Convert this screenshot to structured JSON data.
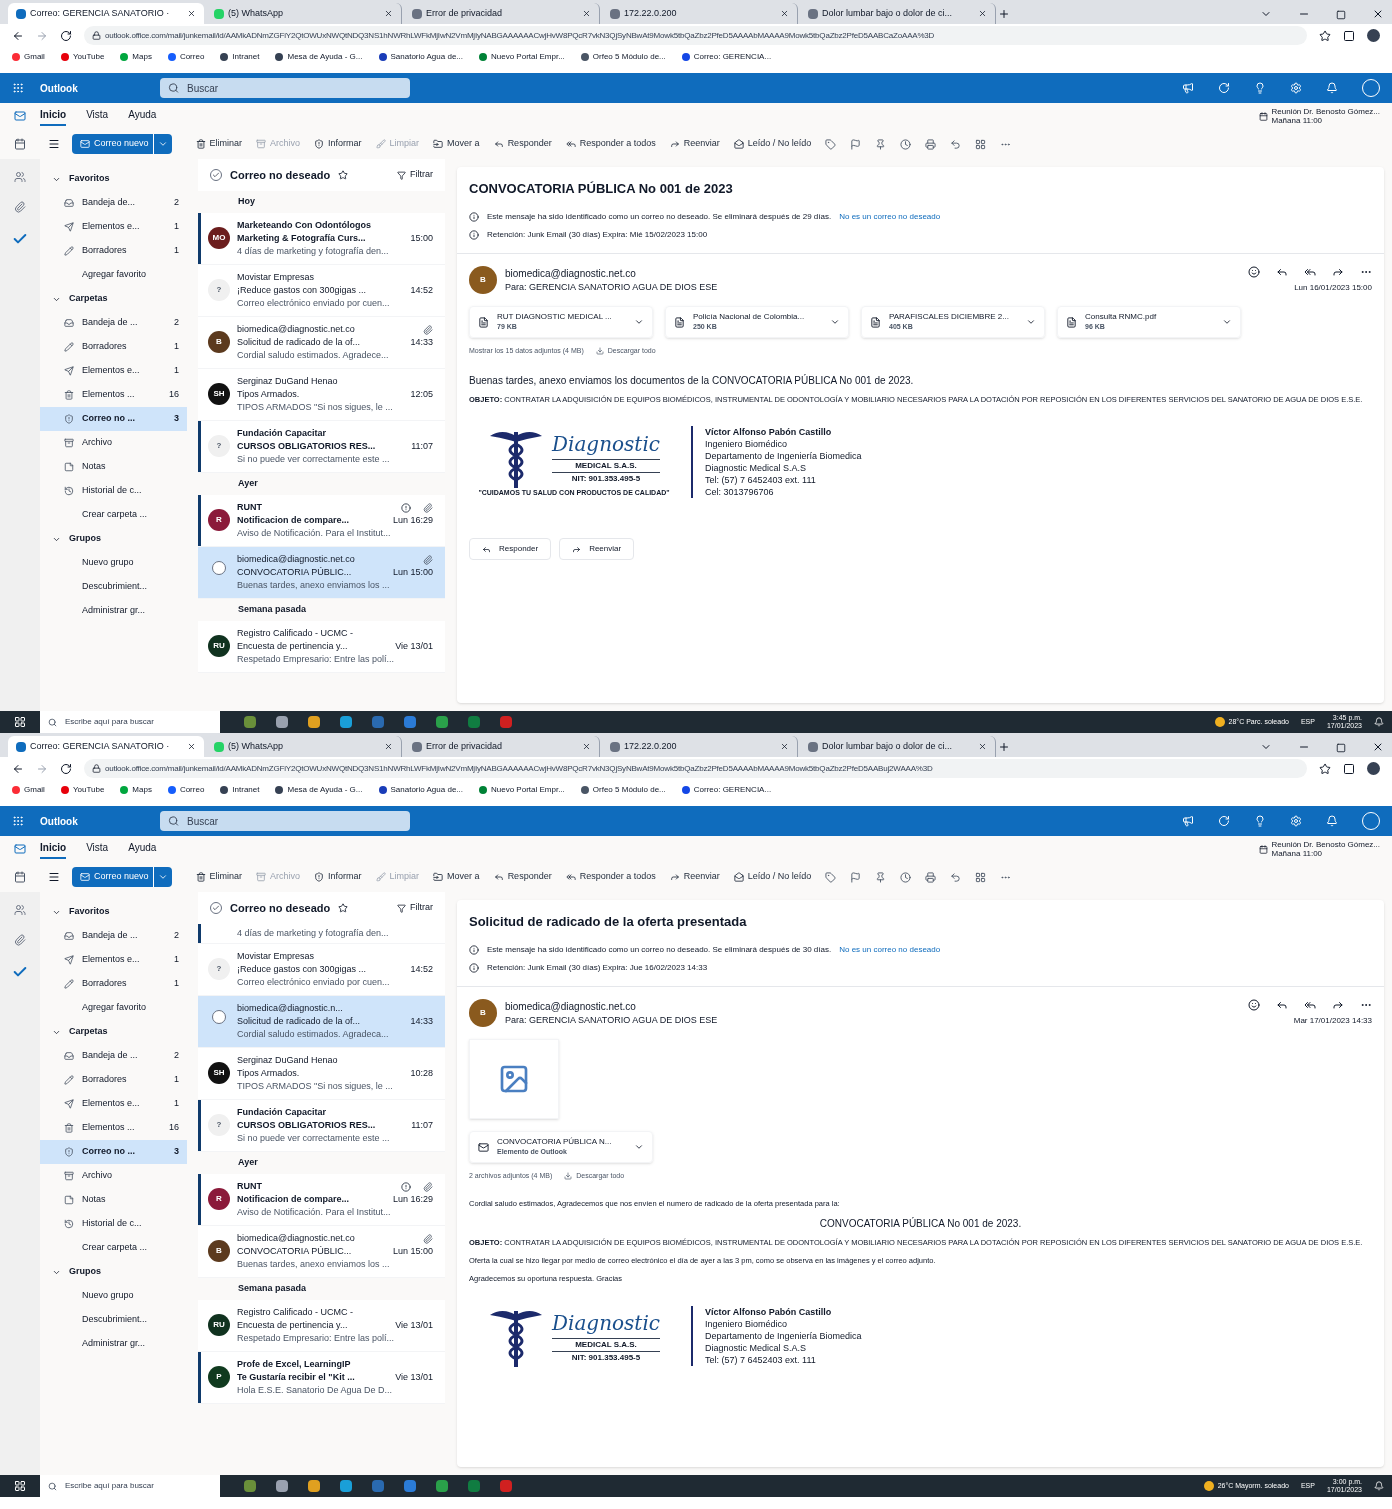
{
  "screens": [
    {
      "browser_tabs": [
        {
          "title": "Correo: GERENCIA SANATORIO ·",
          "selected": true
        },
        {
          "title": "(5) WhatsApp",
          "selected": false
        },
        {
          "title": "Error de privacidad",
          "selected": false
        },
        {
          "title": "172.22.0.200",
          "selected": false
        },
        {
          "title": "Dolor lumbar bajo o dolor de ci...",
          "selected": false
        }
      ],
      "address": "outlook.office.com/mail/junkemail/id/AAMkADNmZGFiY2QtOWUxNWQtNDQ3NS1hNWRhLWFkMjIwN2VmMjIyNABGAAAAAACwjHvW8PQcR7vkN3QjSyNBwAt9Mowk5tbQaZbz2PfeD5AAAAbMAAAA9Mowk5tbQaZbz2PfeD5AABCaZoAAA%3D",
      "bookmarks": [
        "Gmail",
        "YouTube",
        "Maps",
        "Correo",
        "Intranet",
        "Mesa de Ayuda - G...",
        "Sanatorio Agua de...",
        "Nuevo Portal Empr...",
        "Orfeo 5 Módulo de...",
        "Correo: GERENCIA..."
      ],
      "app_name": "Outlook",
      "search_placeholder": "Buscar",
      "reminder": {
        "title": "Reunión Dr. Benosto Gómez...",
        "time": "Mañana 11:00"
      },
      "ribbon_tabs": [
        {
          "label": "Inicio",
          "selected": true
        },
        {
          "label": "Vista",
          "selected": false
        },
        {
          "label": "Ayuda",
          "selected": false
        }
      ],
      "new_mail": "Correo nuevo",
      "toolbar": [
        {
          "label": "Eliminar",
          "disabled": false
        },
        {
          "label": "Archivo",
          "disabled": true
        },
        {
          "label": "Informar",
          "disabled": false
        },
        {
          "label": "Limpiar",
          "disabled": true
        },
        {
          "label": "Mover a",
          "disabled": false
        },
        {
          "label": "Responder",
          "disabled": false
        },
        {
          "label": "Responder a todos",
          "disabled": false
        },
        {
          "label": "Reenviar",
          "disabled": false
        },
        {
          "label": "Leído / No leído",
          "disabled": false
        }
      ],
      "nav_sections": [
        {
          "title": "Favoritos",
          "items": [
            {
              "kind": "inbox",
              "label": "Bandeja de...",
              "count": "2",
              "selected": false
            },
            {
              "kind": "sent",
              "label": "Elementos e...",
              "count": "1",
              "selected": false
            },
            {
              "kind": "drafts",
              "label": "Borradores",
              "count": "1",
              "selected": false
            },
            {
              "kind": "action",
              "label": "Agregar favorito",
              "selected": false
            }
          ]
        },
        {
          "title": "Carpetas",
          "items": [
            {
              "kind": "inbox",
              "label": "Bandeja de ...",
              "count": "2",
              "selected": false
            },
            {
              "kind": "drafts",
              "label": "Borradores",
              "count": "1",
              "selected": false
            },
            {
              "kind": "sent",
              "label": "Elementos e...",
              "count": "1",
              "selected": false
            },
            {
              "kind": "deleted",
              "label": "Elementos ...",
              "count": "16",
              "selected": false
            },
            {
              "kind": "junk",
              "label": "Correo no ...",
              "count": "3",
              "selected": true
            },
            {
              "kind": "archive",
              "label": "Archivo",
              "selected": false
            },
            {
              "kind": "notes",
              "label": "Notas",
              "selected": false
            },
            {
              "kind": "history",
              "label": "Historial de c...",
              "selected": false
            },
            {
              "kind": "action",
              "label": "Crear carpeta ...",
              "selected": false
            }
          ]
        },
        {
          "title": "Grupos",
          "items": [
            {
              "kind": "action",
              "label": "Nuevo grupo",
              "selected": false
            },
            {
              "kind": "action",
              "label": "Descubrimient...",
              "selected": false
            },
            {
              "kind": "action",
              "label": "Administrar gr...",
              "selected": false
            }
          ]
        }
      ],
      "list_title": "Correo no deseado",
      "filter": "Filtrar",
      "groups": [
        {
          "heading": "Hoy",
          "messages": [
            {
              "initials": "MO",
              "color": "#6b1d1d",
              "sender": "Marketeando Con Odontólogos",
              "subject": "Marketing & Fotografía Curs...",
              "time": "15:00",
              "preview": "4 días de marketing y fotografía den...",
              "unread": true,
              "selected": false,
              "attachment": false,
              "important": false
            },
            {
              "initials": "?",
              "color": "#f0f0f0",
              "sender": "Movistar Empresas",
              "subject": "¡Reduce gastos con 300gigas ...",
              "time": "14:52",
              "preview": "Correo electrónico enviado por cuen...",
              "unread": false,
              "selected": false,
              "attachment": false,
              "important": false
            },
            {
              "initials": "B",
              "color": "#5c3a1e",
              "sender": "biomedica@diagnostic.net.co",
              "subject": "Solicitud de radicado de la of...",
              "time": "14:33",
              "preview": "Cordial saludo estimados. Agradece...",
              "unread": false,
              "selected": false,
              "attachment": true,
              "important": false
            },
            {
              "initials": "SH",
              "color": "#111111",
              "sender": "Serginaz DuGand Henao",
              "subject": "Tipos Armados.",
              "time": "12:05",
              "preview": "TIPOS ARMADOS \"Si nos sigues, le ...",
              "unread": false,
              "selected": false,
              "attachment": false,
              "important": false
            },
            {
              "initials": "?",
              "color": "#f0f0f0",
              "sender": "Fundación Capacitar",
              "subject": "CURSOS OBLIGATORIOS RES...",
              "time": "11:07",
              "preview": "Si no puede ver correctamente este ...",
              "unread": true,
              "selected": false,
              "attachment": false,
              "important": false
            }
          ]
        },
        {
          "heading": "Ayer",
          "messages": [
            {
              "initials": "R",
              "color": "#8b1a3a",
              "sender": "RUNT",
              "subject": "Notificacion de compare...",
              "time": "Lun 16:29",
              "preview": "Aviso de Notificación. Para el Institut...",
              "unread": true,
              "selected": false,
              "attachment": true,
              "important": true
            },
            {
              "sender": "biomedica@diagnostic.net.co",
              "subject": "CONVOCATORIA PÚBLIC...",
              "time": "Lun 15:00",
              "preview": "Buenas tardes, anexo enviamos los ...",
              "unread": false,
              "selected": true,
              "attachment": true,
              "important": false
            }
          ]
        },
        {
          "heading": "Semana pasada",
          "messages": [
            {
              "initials": "RU",
              "color": "#10321f",
              "sender": "Registro Calificado - UCMC -",
              "subject": "Encuesta de pertinencia y...",
              "time": "Vie 13/01",
              "preview": "Respetado Empresario: Entre las polí...",
              "unread": false,
              "selected": false,
              "attachment": false,
              "important": false
            }
          ]
        }
      ],
      "reading": {
        "subject": "CONVOCATORIA PÚBLICA No 001 de 2023",
        "notices": [
          {
            "text": "Este mensaje ha sido identificado como un correo no deseado. Se eliminará después de 29 días.",
            "link": "No es un correo no deseado"
          },
          {
            "text": "Retención: Junk Email (30 días) Expira: Mié 15/02/2023 15:00"
          }
        ],
        "avatar": "B",
        "sender": "biomedica@diagnostic.net.co",
        "to": "Para:  GERENCIA SANATORIO AGUA DE DIOS ESE",
        "date": "Lun 16/01/2023 15:00",
        "attachments": [
          {
            "kind": "file",
            "name": "RUT DIAGNOSTIC MEDICAL ...",
            "size": "79 KB"
          },
          {
            "kind": "file",
            "name": "Policía Nacional de Colombia...",
            "size": "250 KB"
          },
          {
            "kind": "file",
            "name": "PARAFISCALES DICIEMBRE 2...",
            "size": "405 KB"
          },
          {
            "kind": "file",
            "name": "Consulta RNMC.pdf",
            "size": "96 KB"
          }
        ],
        "attachments_summary": "Mostrar los 15 datos adjuntos (4 MB)",
        "download_all": "Descargar todo",
        "body": [
          {
            "kind": "text",
            "text": "Buenas tardes, anexo enviamos los documentos de la CONVOCATORIA PÚBLICA No 001 de 2023."
          },
          {
            "kind": "small",
            "text": "**OBJETO:** CONTRATAR LA ADQUISICIÓN DE EQUIPOS BIOMÉDICOS, INSTRUMENTAL DE ODONTOLOGÍA Y MOBILIARIO NECESARIOS PARA LA DOTACIÓN POR REPOSICIÓN EN LOS DIFERENTES SERVICIOS DEL SANATORIO DE AGUA DE DIOS E.S.E."
          }
        ],
        "logo": {
          "brand": "Diagnostic",
          "company": "MEDICAL S.A.S.",
          "nit": "NIT: 901.353.495-5",
          "tagline": "\"CUIDAMOS TU SALUD CON PRODUCTOS DE CALIDAD\""
        },
        "signature": [
          "Víctor Alfonso Pabón Castillo",
          "Ingeniero Biomédico",
          "Departamento de Ingeniería Biomedica",
          "Diagnostic Medical S.A.S",
          "Tel: (57) 7 6452403 ext. 111",
          "Cel: 3013796706"
        ],
        "actions": [
          "Responder",
          "Reenviar"
        ]
      },
      "taskbar": {
        "search_placeholder": "Escribe aquí para buscar",
        "weather": "28°C  Parc. soleado",
        "language": "ESP",
        "time": "3:45 p.m.",
        "date": "17/01/2023"
      }
    },
    {
      "browser_tabs": [
        {
          "title": "Correo: GERENCIA SANATORIO ·",
          "selected": true
        },
        {
          "title": "(5) WhatsApp",
          "selected": false
        },
        {
          "title": "Error de privacidad",
          "selected": false
        },
        {
          "title": "172.22.0.200",
          "selected": false
        },
        {
          "title": "Dolor lumbar bajo o dolor de ci...",
          "selected": false
        }
      ],
      "address": "outlook.office.com/mail/junkemail/id/AAMkADNmZGFiY2QtOWUxNWQtNDQ3NS1hNWRhLWFkMjIwN2VmMjIyNABGAAAAAACwjHvW8PQcR7vkN3QjSyNBwAt9Mowk5tbQaZbz2PfeD5AAAAbMAAAA9Mowk5tbQaZbz2PfeD5AABuj2WAAA%3D",
      "bookmarks": [
        "Gmail",
        "YouTube",
        "Maps",
        "Correo",
        "Intranet",
        "Mesa de Ayuda - G...",
        "Sanatorio Agua de...",
        "Nuevo Portal Empr...",
        "Orfeo 5 Módulo de...",
        "Correo: GERENCIA..."
      ],
      "app_name": "Outlook",
      "search_placeholder": "Buscar",
      "reminder": {
        "title": "Reunión Dr. Benosto Gómez...",
        "time": "Mañana 11:00"
      },
      "ribbon_tabs": [
        {
          "label": "Inicio",
          "selected": true
        },
        {
          "label": "Vista",
          "selected": false
        },
        {
          "label": "Ayuda",
          "selected": false
        }
      ],
      "new_mail": "Correo nuevo",
      "toolbar": [
        {
          "label": "Eliminar",
          "disabled": false
        },
        {
          "label": "Archivo",
          "disabled": true
        },
        {
          "label": "Informar",
          "disabled": false
        },
        {
          "label": "Limpiar",
          "disabled": true
        },
        {
          "label": "Mover a",
          "disabled": false
        },
        {
          "label": "Responder",
          "disabled": false
        },
        {
          "label": "Responder a todos",
          "disabled": false
        },
        {
          "label": "Reenviar",
          "disabled": false
        },
        {
          "label": "Leído / No leído",
          "disabled": false
        }
      ],
      "nav_sections": [
        {
          "title": "Favoritos",
          "items": [
            {
              "kind": "inbox",
              "label": "Bandeja de ...",
              "count": "2",
              "selected": false
            },
            {
              "kind": "sent",
              "label": "Elementos e...",
              "count": "1",
              "selected": false
            },
            {
              "kind": "drafts",
              "label": "Borradores",
              "count": "1",
              "selected": false
            },
            {
              "kind": "action",
              "label": "Agregar favorito",
              "selected": false
            }
          ]
        },
        {
          "title": "Carpetas",
          "items": [
            {
              "kind": "inbox",
              "label": "Bandeja de ...",
              "count": "2",
              "selected": false
            },
            {
              "kind": "drafts",
              "label": "Borradores",
              "count": "1",
              "selected": false
            },
            {
              "kind": "sent",
              "label": "Elementos e...",
              "count": "1",
              "selected": false
            },
            {
              "kind": "deleted",
              "label": "Elementos ...",
              "count": "16",
              "selected": false
            },
            {
              "kind": "junk",
              "label": "Correo no ...",
              "count": "3",
              "selected": true
            },
            {
              "kind": "archive",
              "label": "Archivo",
              "selected": false
            },
            {
              "kind": "notes",
              "label": "Notas",
              "selected": false
            },
            {
              "kind": "history",
              "label": "Historial de c...",
              "selected": false
            },
            {
              "kind": "action",
              "label": "Crear carpeta ...",
              "selected": false
            }
          ]
        },
        {
          "title": "Grupos",
          "items": [
            {
              "kind": "action",
              "label": "Nuevo grupo",
              "selected": false
            },
            {
              "kind": "action",
              "label": "Descubrimient...",
              "selected": false
            },
            {
              "kind": "action",
              "label": "Administrar gr...",
              "selected": false
            }
          ]
        }
      ],
      "list_title": "Correo no deseado",
      "filter": "Filtrar",
      "groups": [
        {
          "messages": [
            {
              "preview": "4 días de marketing y fotografía den...",
              "unread": true,
              "selected": false,
              "attachment": false,
              "important": false
            },
            {
              "initials": "?",
              "color": "#f0f0f0",
              "sender": "Movistar Empresas",
              "subject": "¡Reduce gastos con 300gigas ...",
              "time": "14:52",
              "preview": "Correo electrónico enviado por cuen...",
              "unread": false,
              "selected": false,
              "attachment": false,
              "important": false
            },
            {
              "sender": "biomedica@diagnostic.n...",
              "subject": "Solicitud de radicado de la of...",
              "time": "14:33",
              "preview": "Cordial saludo estimados. Agradeca...",
              "unread": false,
              "selected": true,
              "attachment": false,
              "important": false
            },
            {
              "initials": "SH",
              "color": "#111111",
              "sender": "Serginaz DuGand Henao",
              "subject": "Tipos Armados.",
              "time": "10:28",
              "preview": "TIPOS ARMADOS \"Si nos sigues, le ...",
              "unread": false,
              "selected": false,
              "attachment": false,
              "important": false
            },
            {
              "initials": "?",
              "color": "#f0f0f0",
              "sender": "Fundación Capacitar",
              "subject": "CURSOS OBLIGATORIOS RES...",
              "time": "11:07",
              "preview": "Si no puede ver correctamente este ...",
              "unread": true,
              "selected": false,
              "attachment": false,
              "important": false
            }
          ]
        },
        {
          "heading": "Ayer",
          "messages": [
            {
              "initials": "R",
              "color": "#8b1a3a",
              "sender": "RUNT",
              "subject": "Notificacion de compare...",
              "time": "Lun 16:29",
              "preview": "Aviso de Notificación. Para el Institut...",
              "unread": true,
              "selected": false,
              "attachment": true,
              "important": true
            },
            {
              "initials": "B",
              "color": "#5c3a1e",
              "sender": "biomedica@diagnostic.net.co",
              "subject": "CONVOCATORIA PÚBLIC...",
              "time": "Lun 15:00",
              "preview": "Buenas tardes, anexo enviamos los ...",
              "unread": false,
              "selected": false,
              "attachment": true,
              "important": false
            }
          ]
        },
        {
          "heading": "Semana pasada",
          "messages": [
            {
              "initials": "RU",
              "color": "#10321f",
              "sender": "Registro Calificado - UCMC -",
              "subject": "Encuesta de pertinencia y...",
              "time": "Vie 13/01",
              "preview": "Respetado Empresario: Entre las polí...",
              "unread": false,
              "selected": false,
              "attachment": false,
              "important": false
            },
            {
              "initials": "P",
              "color": "#103a1f",
              "sender": "Profe de Excel, LearningIP",
              "subject": "Te Gustaría recibir el \"Kit ...",
              "time": "Vie 13/01",
              "preview": "Hola E.S.E. Sanatorio De Agua De D...",
              "unread": true,
              "selected": false,
              "attachment": false,
              "important": false
            }
          ]
        }
      ],
      "reading": {
        "subject": "Solicitud de radicado de la oferta presentada",
        "notices": [
          {
            "text": "Este mensaje ha sido identificado como un correo no deseado. Se eliminará después de 30 días.",
            "link": "No es un correo no deseado"
          },
          {
            "text": "Retención: Junk Email (30 días) Expira: Jue 16/02/2023 14:33"
          }
        ],
        "avatar": "B",
        "sender": "biomedica@diagnostic.net.co",
        "to": "Para:  GERENCIA SANATORIO AGUA DE DIOS ESE",
        "date": "Mar 17/01/2023 14:33",
        "image_attachment": true,
        "attachments": [
          {
            "kind": "item",
            "name": "CONVOCATORIA PÚBLICA N...",
            "size": "Elemento de Outlook"
          }
        ],
        "attachments_summary": "2 archivos adjuntos (4 MB)",
        "download_all": "Descargar todo",
        "body": [
          {
            "kind": "small",
            "text": "Cordial saludo estimados, Agradecemos que nos envíen el numero de radicado de la oferta presentada para la:"
          },
          {
            "kind": "center",
            "text": "CONVOCATORIA PÚBLICA No 001 de 2023."
          },
          {
            "kind": "small",
            "text": "**OBJETO:** CONTRATAR LA ADQUISICIÓN DE EQUIPOS BIOMÉDICOS, INSTRUMENTAL DE ODONTOLOGÍA Y MOBILIARIO NECESARIOS PARA LA DOTACIÓN POR REPOSICIÓN EN LOS DIFERENTES SERVICIOS DEL SANATORIO DE AGUA DE DIOS E.S.E."
          },
          {
            "kind": "small",
            "text": "Oferta la cual se hizo llegar por medio de correo electrónico el día de ayer a las 3 pm, como se observa en las imágenes y el correo adjunto."
          },
          {
            "kind": "small",
            "text": "Agradecemos su oportuna respuesta. Gracias"
          }
        ],
        "logo": {
          "brand": "Diagnostic",
          "company": "MEDICAL S.A.S.",
          "nit": "NIT: 901.353.495-5"
        },
        "signature": [
          "Víctor Alfonso Pabón Castillo",
          "Ingeniero Biomédico",
          "Departamento de Ingeniería Biomedica",
          "Diagnostic Medical S.A.S",
          "Tel: (57) 7 6452403 ext. 111"
        ]
      },
      "taskbar": {
        "search_placeholder": "Escribe aquí para buscar",
        "weather": "26°C  Mayorm. soleado",
        "language": "ESP",
        "time": "3:00 p.m.",
        "date": "17/01/2023"
      }
    }
  ]
}
